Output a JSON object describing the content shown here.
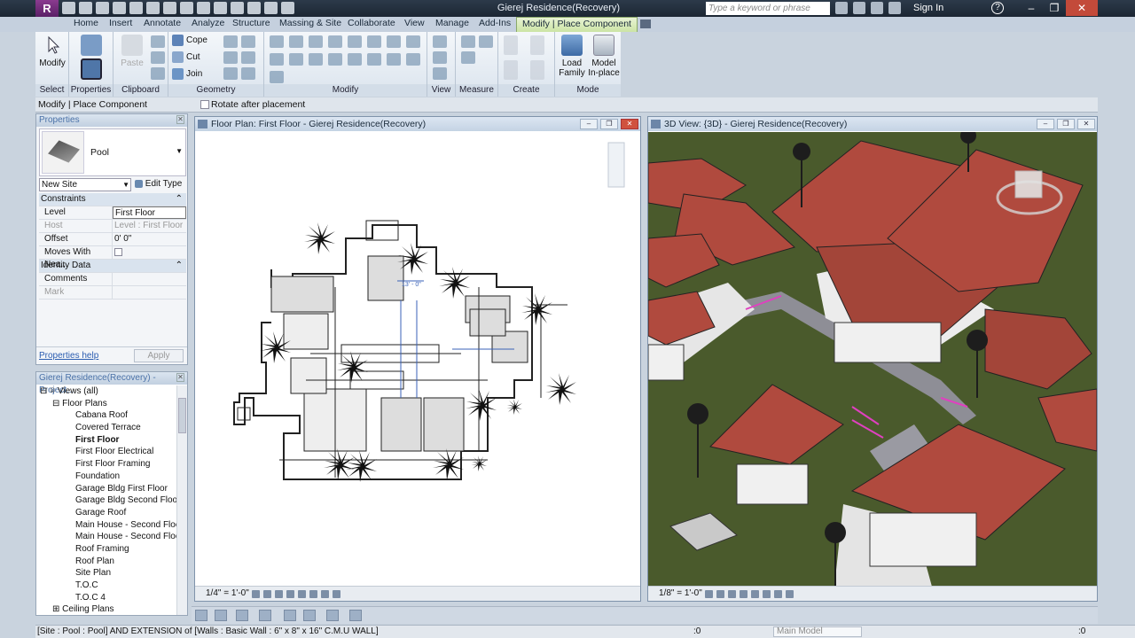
{
  "app": {
    "logo_letter": "R",
    "title": "Gierej Residence(Recovery)",
    "search_placeholder": "Type a keyword or phrase",
    "sign_in": "Sign In",
    "help": "?"
  },
  "ribbon": {
    "tabs": [
      "Home",
      "Insert",
      "Annotate",
      "Analyze",
      "Structure",
      "Massing & Site",
      "Collaborate",
      "View",
      "Manage",
      "Add-Ins",
      "Modify | Place Component"
    ],
    "active_tab": "Modify | Place Component",
    "modify_btn": "Modify",
    "paste_btn": "Paste",
    "cope": "Cope",
    "cut": "Cut",
    "join": "Join",
    "load_family": "Load Family",
    "model_inplace": "Model In-place",
    "panels": {
      "select": "Select",
      "properties": "Properties",
      "clipboard": "Clipboard",
      "geometry": "Geometry",
      "modify": "Modify",
      "view": "View",
      "measure": "Measure",
      "create": "Create",
      "mode": "Mode"
    }
  },
  "options_bar": {
    "context": "Modify | Place Component",
    "rotate_label": "Rotate after placement"
  },
  "properties": {
    "header": "Properties",
    "type_name": "Pool",
    "instance_filter": "New Site",
    "edit_type": "Edit Type",
    "groups": {
      "constraints": "Constraints",
      "identity": "Identity Data"
    },
    "rows": {
      "level_k": "Level",
      "level_v": "First Floor",
      "host_k": "Host",
      "host_v": "Level : First Floor",
      "offset_k": "Offset",
      "offset_v": "0'  0\"",
      "moves_k": "Moves With Nea...",
      "comments_k": "Comments",
      "mark_k": "Mark"
    },
    "help_link": "Properties help",
    "apply": "Apply"
  },
  "browser": {
    "header": "Gierej Residence(Recovery) - Project...",
    "views_all": "Views (all)",
    "floor_plans": "Floor Plans",
    "items": [
      "Cabana Roof",
      "Covered Terrace",
      "First Floor",
      "First Floor Electrical",
      "First Floor Framing",
      "Foundation",
      "Garage Bldg First Floor",
      "Garage Bldg Second Floor",
      "Garage Roof",
      "Main House - Second Floo",
      "Main House - Second Floo",
      "Roof Framing",
      "Roof Plan",
      "Site Plan",
      "T.O.C",
      "T.O.C 4"
    ],
    "selected": "First Floor",
    "ceiling_plans": "Ceiling Plans"
  },
  "floor_view": {
    "title": "Floor Plan: First Floor - Gierej Residence(Recovery)",
    "scale": "1/4\" = 1'-0\"",
    "dim_label": "13' - 0\""
  },
  "view3d": {
    "title": "3D View: {3D} - Gierej Residence(Recovery)",
    "scale": "1/8\" = 1'-0\""
  },
  "status": {
    "message": "[Site : Pool : Pool] AND EXTENSION  of [Walls : Basic Wall : 6\" x 8\" x 16\" C.M.U WALL]",
    "count": ":0",
    "model_placeholder": "Main Model",
    "filter": ":0"
  },
  "colors": {
    "roof": "#b04a3e",
    "grass": "#4a5a2c",
    "accent": "#cbe4a4"
  }
}
